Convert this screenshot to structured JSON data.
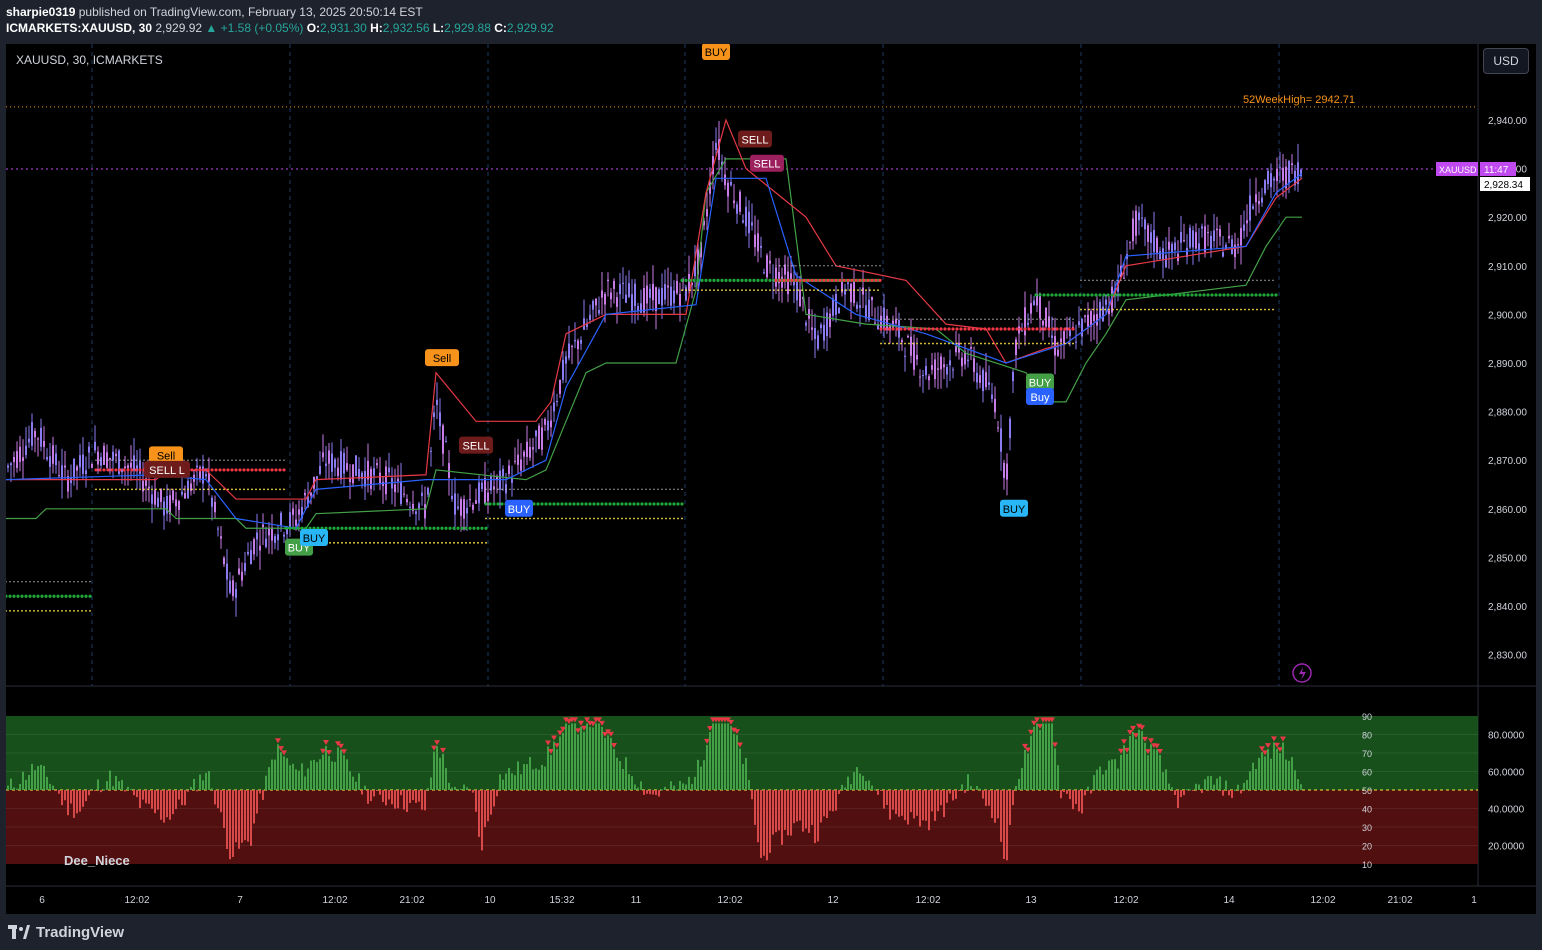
{
  "header": {
    "author": "sharpie0319",
    "published": "published on TradingView.com, February 13, 2025 20:50:14 EST",
    "symbol": "ICMARKETS:XAUUSD, 30",
    "last": "2,929.92",
    "change": "▲ +1.58 (+0.05%)",
    "o_label": "O:",
    "o": "2,931.30",
    "h_label": "H:",
    "h": "2,932.56",
    "l_label": "L:",
    "l": "2,929.88",
    "c_label": "C:",
    "c": "2,929.92"
  },
  "chart": {
    "symbol_label": "XAUUSD, 30, ICMARKETS",
    "currency_button": "USD",
    "week_high_label": "52WeekHigh= 2942.71",
    "price_tag": {
      "symbol": "XAUUSD",
      "countdown": "11:47",
      "price": "2,928.34"
    },
    "price_axis": [
      "2,940.00",
      "2,930.00",
      "2,920.00",
      "2,910.00",
      "2,900.00",
      "2,890.00",
      "2,880.00",
      "2,870.00",
      "2,860.00",
      "2,850.00",
      "2,840.00",
      "2,830.00"
    ],
    "time_axis": [
      "6",
      "12:02",
      "7",
      "12:02",
      "21:02",
      "10",
      "15:32",
      "11",
      "12:02",
      "12",
      "12:02",
      "13",
      "12:02",
      "14",
      "12:02",
      "21:02",
      "1"
    ],
    "signals": [
      "Sell",
      "SELL",
      "SELL",
      "SELL L",
      "Sell",
      "SELL",
      "BUY",
      "BUY",
      "BUY",
      "BUY",
      "Buy",
      "BUY",
      "BUY"
    ],
    "colors": {
      "bg": "#000000",
      "up": "#8a7cf0",
      "red_line": "#e53945",
      "green_line": "#43a047",
      "blue_line": "#2962ff",
      "dots_green": "#1fa83a",
      "dots_red": "#f23645",
      "dots_yellow": "#ffe24a",
      "orange": "#f7931a"
    }
  },
  "oscillator": {
    "name": "Dee_Niece",
    "levels_left": [
      "90",
      "80",
      "70",
      "60",
      "50",
      "40",
      "30",
      "20",
      "10"
    ],
    "levels_right": [
      "80.0000",
      "60.0000",
      "40.0000",
      "20.0000"
    ]
  },
  "footer": {
    "brand": "TradingView"
  }
}
